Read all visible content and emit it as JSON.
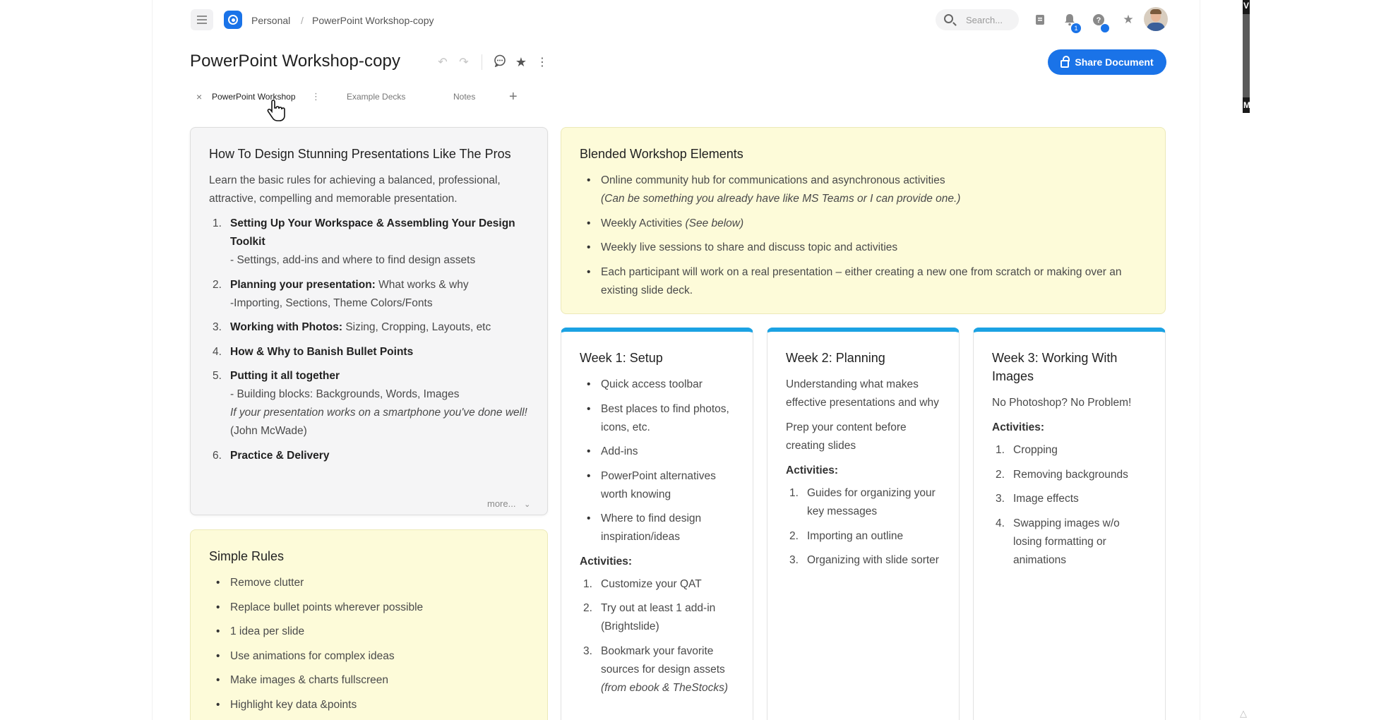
{
  "breadcrumb": {
    "workspace": "Personal",
    "separator": "/",
    "document": "PowerPoint Workshop-copy"
  },
  "search": {
    "placeholder": "Search..."
  },
  "notifications": {
    "count": "1"
  },
  "title": "PowerPoint Workshop-copy",
  "share_button": "Share Document",
  "tabs": [
    {
      "label": "PowerPoint Workshop"
    },
    {
      "label": "Example Decks"
    },
    {
      "label": "Notes"
    }
  ],
  "colors": {
    "accent": "#1a73e8",
    "card_top": "#1ba2e3",
    "yellow_card": "#fdfbd9",
    "gray_card": "#f5f5f6"
  },
  "main_card": {
    "title": "How To Design Stunning Presentations Like The Pros",
    "intro": "Learn the basic rules for achieving a balanced, professional, attractive, compelling and memorable presentation.",
    "items": [
      {
        "num": "1.",
        "bold": "Setting Up Your Workspace & Assembling Your Design Toolkit",
        "rest": "",
        "sub": "- Settings, add-ins and where to find design assets"
      },
      {
        "num": "2.",
        "bold": "Planning your presentation:",
        "rest": " What works & why",
        "sub": "-Importing, Sections, Theme Colors/Fonts"
      },
      {
        "num": "3.",
        "bold": "Working with Photos:",
        "rest": " Sizing, Cropping, Layouts, etc",
        "sub": ""
      },
      {
        "num": "4.",
        "bold": "How & Why to Banish Bullet Points",
        "rest": "",
        "sub": ""
      },
      {
        "num": "5.",
        "bold": "Putting it all together",
        "rest": "",
        "sub": "- Building blocks: Backgrounds, Words, Images",
        "quote": "If your presentation works on a smartphone you've done well!",
        "quote_author": " (John McWade)"
      },
      {
        "num": "6.",
        "bold": "Practice & Delivery",
        "rest": "",
        "sub": ""
      }
    ],
    "more": "more..."
  },
  "blended": {
    "title": "Blended Workshop Elements",
    "items": [
      {
        "text": "Online community hub for communications and asynchronous activities",
        "note": "(Can be something you already have like MS Teams or I can provide one.)"
      },
      {
        "text": "Weekly Activities ",
        "note": "(See below)"
      },
      {
        "text": "Weekly live sessions to share and discuss topic and activities",
        "note": ""
      },
      {
        "text": "Each participant will work on a real presentation – either creating a new one from scratch or making over an existing slide deck.",
        "note": ""
      }
    ]
  },
  "week1": {
    "title": "Week 1: Setup",
    "bullets": [
      "Quick access toolbar",
      "Best places to find photos, icons, etc.",
      "Add-ins",
      "PowerPoint alternatives worth knowing",
      "Where to find design inspiration/ideas"
    ],
    "activities_label": "Activities:",
    "activities": [
      {
        "num": "1.",
        "text": "Customize your QAT",
        "note": ""
      },
      {
        "num": "2.",
        "text": "Try out at least 1 add-in (Brightslide)",
        "note": ""
      },
      {
        "num": "3.",
        "text": "Bookmark your favorite sources for design assets ",
        "note": "(from ebook & TheStocks)"
      }
    ]
  },
  "week2": {
    "title": "Week 2: Planning",
    "p1": "Understanding what makes effective presentations and why",
    "p2": "Prep your content before creating slides",
    "activities_label": "Activities:",
    "activities": [
      {
        "num": "1.",
        "text": "Guides for organizing your key messages"
      },
      {
        "num": "2.",
        "text": "Importing an outline"
      },
      {
        "num": "3.",
        "text": "Organizing with slide sorter"
      }
    ]
  },
  "week3": {
    "title": "Week 3: Working With Images",
    "p1": "No Photoshop? No Problem!",
    "activities_label": "Activities:",
    "activities": [
      {
        "num": "1.",
        "text": "Cropping"
      },
      {
        "num": "2.",
        "text": "Removing backgrounds"
      },
      {
        "num": "3.",
        "text": "Image effects"
      },
      {
        "num": "4.",
        "text": "Swapping images w/o losing formatting or animations"
      }
    ]
  },
  "rules": {
    "title": "Simple Rules",
    "items": [
      "Remove clutter",
      "Replace bullet points wherever possible",
      "1 idea per slide",
      "Use animations for complex ideas",
      "Make images & charts fullscreen",
      "Highlight key data &points"
    ]
  }
}
